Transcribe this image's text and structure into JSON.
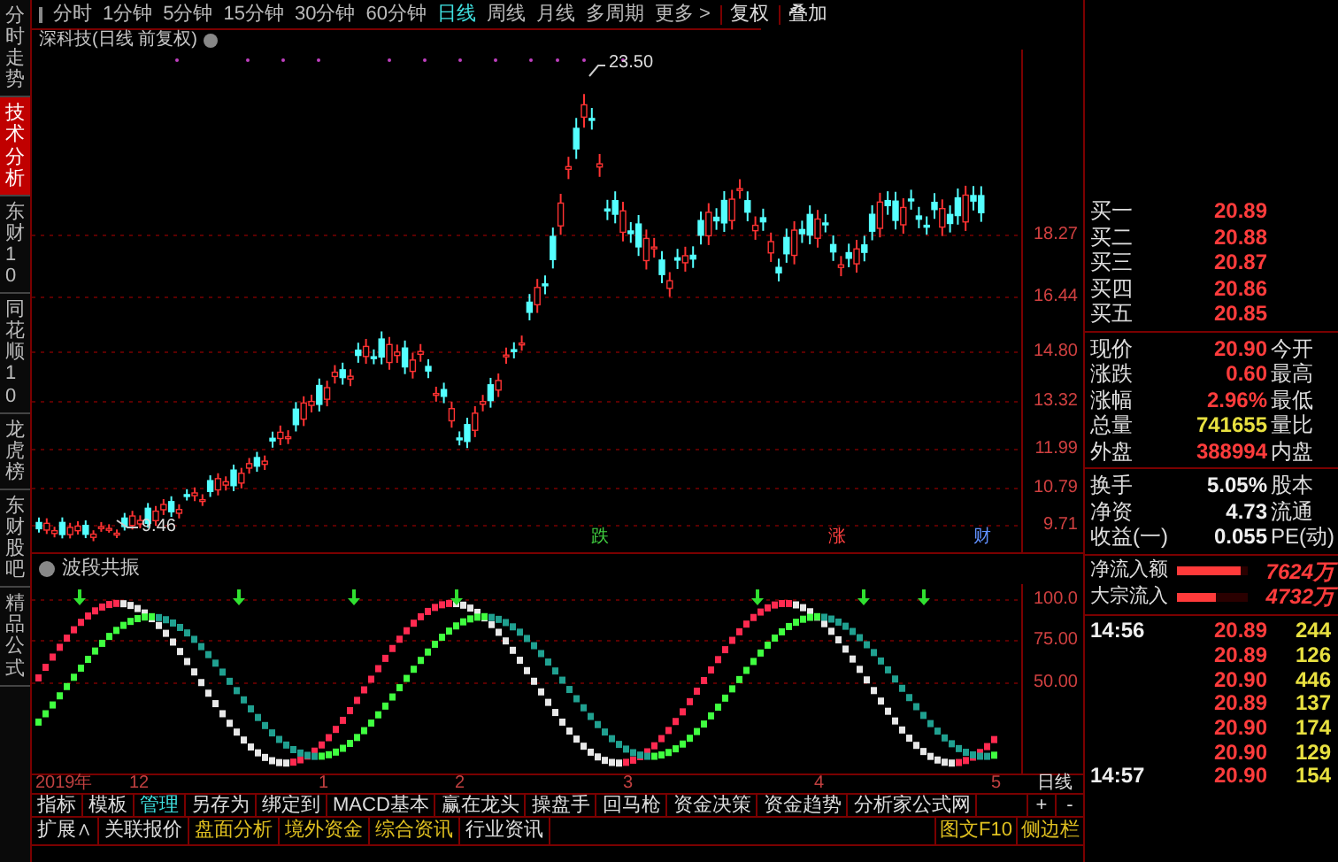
{
  "sidebar_tabs": [
    {
      "label": "分时走势",
      "selected": false
    },
    {
      "label": "技术分析",
      "selected": true
    },
    {
      "label": "东财10",
      "selected": false
    },
    {
      "label": "同花顺10",
      "selected": false
    },
    {
      "label": "龙虎榜",
      "selected": false
    },
    {
      "label": "东财股吧",
      "selected": false
    },
    {
      "label": "精品公式",
      "selected": false
    }
  ],
  "period_tabs": [
    {
      "label": "分时",
      "selected": false
    },
    {
      "label": "1分钟",
      "selected": false
    },
    {
      "label": "5分钟",
      "selected": false
    },
    {
      "label": "15分钟",
      "selected": false
    },
    {
      "label": "30分钟",
      "selected": false
    },
    {
      "label": "60分钟",
      "selected": false
    },
    {
      "label": "日线",
      "selected": true
    },
    {
      "label": "周线",
      "selected": false
    },
    {
      "label": "月线",
      "selected": false
    },
    {
      "label": "多周期",
      "selected": false
    },
    {
      "label": "更多 >",
      "selected": false
    }
  ],
  "right_buttons": [
    "复权",
    "叠加"
  ],
  "chart": {
    "title": "深科技(日线 前复权)",
    "high_label": "23.50",
    "low_label": "9.46",
    "price_ticks": [
      "18.27",
      "16.44",
      "14.80",
      "13.32",
      "11.99",
      "10.79",
      "9.71"
    ],
    "signals": [
      {
        "label": "跌",
        "kind": "down"
      },
      {
        "label": "涨",
        "kind": "up"
      },
      {
        "label": "财",
        "kind": "news"
      }
    ]
  },
  "indicator": {
    "title": "波段共振",
    "ticks": [
      "100.0",
      "75.00",
      "50.00"
    ]
  },
  "x_axis": {
    "labels": [
      "2019年",
      "12",
      "1",
      "2",
      "3",
      "4",
      "5"
    ],
    "period": "日线"
  },
  "zoom_buttons": [
    "+",
    "-"
  ],
  "indicator_tabs": [
    {
      "label": "指标",
      "selected": false
    },
    {
      "label": "模板",
      "selected": false
    },
    {
      "label": "管理",
      "selected": true
    },
    {
      "label": "另存为",
      "selected": false
    },
    {
      "label": "绑定到",
      "selected": false
    },
    {
      "label": "MACD基本",
      "selected": false
    },
    {
      "label": "赢在龙头",
      "selected": false
    },
    {
      "label": "操盘手",
      "selected": false
    },
    {
      "label": "回马枪",
      "selected": false
    },
    {
      "label": "资金决策",
      "selected": false
    },
    {
      "label": "资金趋势",
      "selected": false
    },
    {
      "label": "分析家公式网",
      "selected": false
    }
  ],
  "bottom_tabs": [
    {
      "label": "扩展∧",
      "highlight": false
    },
    {
      "label": "关联报价",
      "highlight": false
    },
    {
      "label": "盘面分析",
      "highlight": true
    },
    {
      "label": "境外资金",
      "highlight": true
    },
    {
      "label": "综合资讯",
      "highlight": true
    },
    {
      "label": "行业资讯",
      "highlight": false
    }
  ],
  "side_buttons": [
    "图文F10",
    "侧边栏"
  ],
  "order_book": [
    {
      "label": "买一",
      "price": "20.89"
    },
    {
      "label": "买二",
      "price": "20.88"
    },
    {
      "label": "买三",
      "price": "20.87"
    },
    {
      "label": "买四",
      "price": "20.86"
    },
    {
      "label": "买五",
      "price": "20.85"
    }
  ],
  "quote": [
    {
      "label": "现价",
      "value": "20.90",
      "color": "#ff3c3c",
      "label2": "今开"
    },
    {
      "label": "涨跌",
      "value": "0.60",
      "color": "#ff3c3c",
      "label2": "最高"
    },
    {
      "label": "涨幅",
      "value": "2.96%",
      "color": "#ff3c3c",
      "label2": "最低"
    },
    {
      "label": "总量",
      "value": "741655",
      "color": "#e8e040",
      "label2": "量比"
    },
    {
      "label": "外盘",
      "value": "388994",
      "color": "#ff3c3c",
      "label2": "内盘"
    }
  ],
  "stats": [
    {
      "label": "换手",
      "value": "5.05%",
      "label2": "股本"
    },
    {
      "label": "净资",
      "value": "4.73",
      "label2": "流通"
    },
    {
      "label": "收益(一)",
      "value": "0.055",
      "label2": "PE(动)"
    }
  ],
  "flows": [
    {
      "label": "净流入额",
      "level": 0.9,
      "value": "7624万"
    },
    {
      "label": "大宗流入",
      "level": 0.55,
      "value": "4732万"
    }
  ],
  "ticks": [
    {
      "time": "14:56",
      "price": "20.89",
      "volume": "244"
    },
    {
      "price": "20.89",
      "volume": "126"
    },
    {
      "price": "20.90",
      "volume": "446"
    },
    {
      "price": "20.89",
      "volume": "137"
    },
    {
      "price": "20.90",
      "volume": "174"
    },
    {
      "price": "20.90",
      "volume": "129"
    },
    {
      "time": "14:57",
      "price": "20.90",
      "volume": "154"
    }
  ]
}
